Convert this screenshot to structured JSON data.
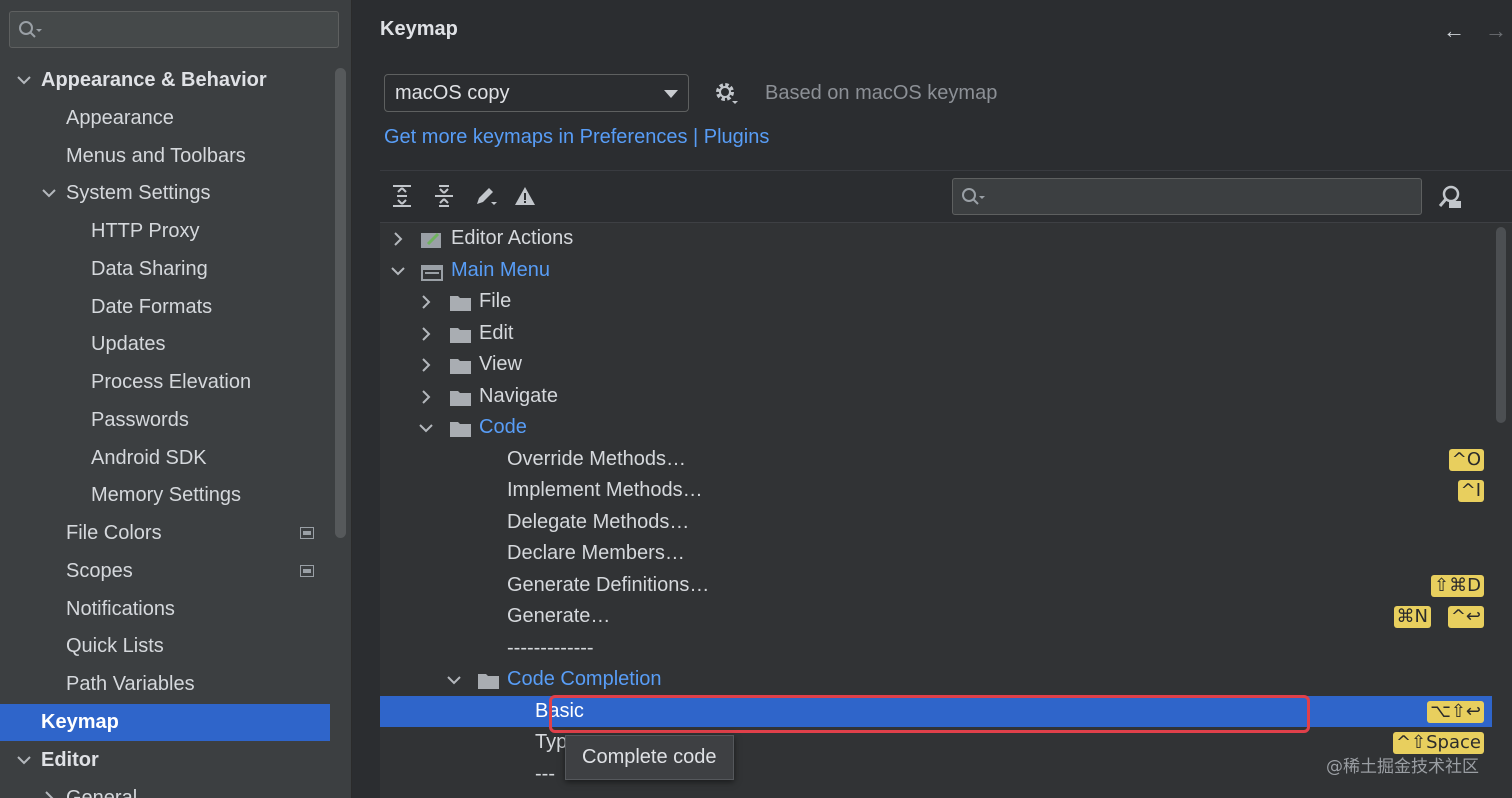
{
  "sidebar": {
    "search_placeholder": "",
    "items": [
      {
        "label": "Appearance & Behavior"
      },
      {
        "label": "Appearance"
      },
      {
        "label": "Menus and Toolbars"
      },
      {
        "label": "System Settings"
      },
      {
        "label": "HTTP Proxy"
      },
      {
        "label": "Data Sharing"
      },
      {
        "label": "Date Formats"
      },
      {
        "label": "Updates"
      },
      {
        "label": "Process Elevation"
      },
      {
        "label": "Passwords"
      },
      {
        "label": "Android SDK"
      },
      {
        "label": "Memory Settings"
      },
      {
        "label": "File Colors"
      },
      {
        "label": "Scopes"
      },
      {
        "label": "Notifications"
      },
      {
        "label": "Quick Lists"
      },
      {
        "label": "Path Variables"
      },
      {
        "label": "Keymap"
      },
      {
        "label": "Editor"
      },
      {
        "label": "General"
      }
    ]
  },
  "main": {
    "title": "Keymap",
    "nav_back": "←",
    "nav_forward": "→",
    "keymap_select": {
      "value": "macOS copy"
    },
    "based_on": "Based on macOS keymap",
    "plugins_link": "Get more keymaps in Preferences | Plugins",
    "tree_search_placeholder": ""
  },
  "tree": [
    {
      "label": "Editor Actions"
    },
    {
      "label": "Main Menu"
    },
    {
      "label": "File"
    },
    {
      "label": "Edit"
    },
    {
      "label": "View"
    },
    {
      "label": "Navigate"
    },
    {
      "label": "Code"
    },
    {
      "label": "Override Methods…",
      "shortcuts": [
        "^O"
      ]
    },
    {
      "label": "Implement Methods…",
      "shortcuts": [
        "^I"
      ]
    },
    {
      "label": "Delegate Methods…"
    },
    {
      "label": "Declare Members…"
    },
    {
      "label": "Generate Definitions…",
      "shortcuts": [
        "⇧⌘D"
      ]
    },
    {
      "label": "Generate…",
      "shortcuts": [
        "⌘N",
        "^↩"
      ]
    },
    {
      "label": "-------------"
    },
    {
      "label": "Code Completion"
    },
    {
      "label": "Basic",
      "shortcuts": [
        "⌥⇧↩"
      ]
    },
    {
      "label": "Typ",
      "shortcuts": [
        "^⇧Space"
      ]
    },
    {
      "label": "---"
    }
  ],
  "tooltip": "Complete code",
  "watermark": "@稀土掘金技术社区",
  "colors": {
    "accent": "#2f65ca",
    "link": "#589df6",
    "shortcut_bg": "#e8cf5e",
    "highlight_border": "#e0404a"
  }
}
